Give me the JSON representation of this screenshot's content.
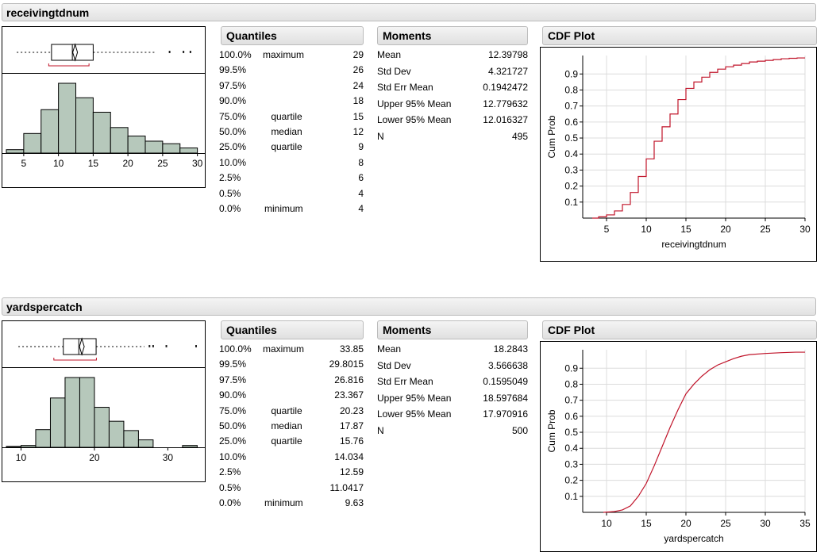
{
  "sections": [
    {
      "title": "receivingtdnum",
      "quantiles_title": "Quantiles",
      "moments_title": "Moments",
      "cdf_title": "CDF Plot",
      "quantiles": [
        {
          "pct": "100.0%",
          "label": "maximum",
          "value": "29"
        },
        {
          "pct": "99.5%",
          "label": "",
          "value": "26"
        },
        {
          "pct": "97.5%",
          "label": "",
          "value": "24"
        },
        {
          "pct": "90.0%",
          "label": "",
          "value": "18"
        },
        {
          "pct": "75.0%",
          "label": "quartile",
          "value": "15"
        },
        {
          "pct": "50.0%",
          "label": "median",
          "value": "12"
        },
        {
          "pct": "25.0%",
          "label": "quartile",
          "value": "9"
        },
        {
          "pct": "10.0%",
          "label": "",
          "value": "8"
        },
        {
          "pct": "2.5%",
          "label": "",
          "value": "6"
        },
        {
          "pct": "0.5%",
          "label": "",
          "value": "4"
        },
        {
          "pct": "0.0%",
          "label": "minimum",
          "value": "4"
        }
      ],
      "moments": [
        {
          "label": "Mean",
          "value": "12.39798"
        },
        {
          "label": "Std Dev",
          "value": "4.321727"
        },
        {
          "label": "Std Err Mean",
          "value": "0.1942472"
        },
        {
          "label": "Upper 95% Mean",
          "value": "12.779632"
        },
        {
          "label": "Lower 95% Mean",
          "value": "12.016327"
        },
        {
          "label": "N",
          "value": "495"
        }
      ]
    },
    {
      "title": "yardspercatch",
      "quantiles_title": "Quantiles",
      "moments_title": "Moments",
      "cdf_title": "CDF Plot",
      "quantiles": [
        {
          "pct": "100.0%",
          "label": "maximum",
          "value": "33.85"
        },
        {
          "pct": "99.5%",
          "label": "",
          "value": "29.8015"
        },
        {
          "pct": "97.5%",
          "label": "",
          "value": "26.816"
        },
        {
          "pct": "90.0%",
          "label": "",
          "value": "23.367"
        },
        {
          "pct": "75.0%",
          "label": "quartile",
          "value": "20.23"
        },
        {
          "pct": "50.0%",
          "label": "median",
          "value": "17.87"
        },
        {
          "pct": "25.0%",
          "label": "quartile",
          "value": "15.76"
        },
        {
          "pct": "10.0%",
          "label": "",
          "value": "14.034"
        },
        {
          "pct": "2.5%",
          "label": "",
          "value": "12.59"
        },
        {
          "pct": "0.5%",
          "label": "",
          "value": "11.0417"
        },
        {
          "pct": "0.0%",
          "label": "minimum",
          "value": "9.63"
        }
      ],
      "moments": [
        {
          "label": "Mean",
          "value": "18.2843"
        },
        {
          "label": "Std Dev",
          "value": "3.566638"
        },
        {
          "label": "Std Err Mean",
          "value": "0.1595049"
        },
        {
          "label": "Upper 95% Mean",
          "value": "18.597684"
        },
        {
          "label": "Lower 95% Mean",
          "value": "17.970916"
        },
        {
          "label": "N",
          "value": "500"
        }
      ]
    }
  ],
  "chart_data": [
    {
      "type": "bar",
      "variable": "receivingtdnum",
      "bin_edges": [
        2.5,
        5,
        7.5,
        10,
        12.5,
        15,
        17.5,
        20,
        22.5,
        25,
        27.5,
        30
      ],
      "values": [
        4,
        23,
        51,
        82,
        65,
        48,
        30,
        20,
        14,
        11,
        6
      ],
      "xticks": [
        "5",
        "10",
        "15",
        "20",
        "25",
        "30"
      ],
      "xlim": [
        2.5,
        30.5
      ],
      "boxplot": {
        "q1": 9,
        "median": 12,
        "q3": 15,
        "mean": 12.39798,
        "whisker_low": 4,
        "whisker_high": 24,
        "outliers": [
          26,
          28,
          29
        ]
      },
      "fill": "#b6c8bb",
      "line": "#000000"
    },
    {
      "type": "line",
      "variable": "receivingtdnum",
      "xlabel": "receivingtdnum",
      "ylabel": "Cum Prob",
      "xticks": [
        "5",
        "10",
        "15",
        "20",
        "25",
        "30"
      ],
      "yticks": [
        "0.1",
        "0.2",
        "0.3",
        "0.4",
        "0.5",
        "0.6",
        "0.7",
        "0.8",
        "0.9"
      ],
      "xlim": [
        2,
        30
      ],
      "ylim": [
        0,
        1
      ],
      "grid": true,
      "step": true,
      "x": [
        4,
        5,
        6,
        7,
        8,
        9,
        10,
        11,
        12,
        13,
        14,
        15,
        16,
        17,
        18,
        19,
        20,
        21,
        22,
        23,
        24,
        25,
        26,
        27,
        28,
        29
      ],
      "y": [
        0.008,
        0.02,
        0.045,
        0.085,
        0.16,
        0.26,
        0.37,
        0.48,
        0.57,
        0.65,
        0.74,
        0.81,
        0.85,
        0.88,
        0.91,
        0.93,
        0.945,
        0.955,
        0.965,
        0.975,
        0.98,
        0.985,
        0.99,
        0.995,
        0.998,
        1.0
      ],
      "color": "#c0142a"
    },
    {
      "type": "bar",
      "variable": "yardspercatch",
      "bin_edges": [
        8,
        10,
        12,
        14,
        16,
        18,
        20,
        22,
        24,
        26,
        28,
        30,
        32,
        34
      ],
      "values": [
        1,
        2,
        19,
        53,
        75,
        75,
        43,
        28,
        18,
        8,
        0,
        0,
        2
      ],
      "xticks": [
        "10",
        "20",
        "30"
      ],
      "xlim": [
        8,
        34.5
      ],
      "boxplot": {
        "q1": 15.76,
        "median": 17.87,
        "q3": 20.23,
        "mean": 18.2843,
        "whisker_low": 9.63,
        "whisker_high": 26.816,
        "outliers": [
          27.5,
          28,
          29.8,
          33.85
        ]
      },
      "fill": "#b6c8bb",
      "line": "#000000"
    },
    {
      "type": "line",
      "variable": "yardspercatch",
      "xlabel": "yardspercatch",
      "ylabel": "Cum Prob",
      "xticks": [
        "10",
        "15",
        "20",
        "25",
        "30",
        "35"
      ],
      "yticks": [
        "0.1",
        "0.2",
        "0.3",
        "0.4",
        "0.5",
        "0.6",
        "0.7",
        "0.8",
        "0.9"
      ],
      "xlim": [
        7,
        35
      ],
      "ylim": [
        0,
        1
      ],
      "grid": true,
      "step": false,
      "x": [
        9.6,
        11,
        12,
        13,
        14,
        15,
        16,
        17,
        18,
        19,
        20,
        21,
        22,
        23,
        24,
        25,
        26,
        27,
        28,
        30,
        32,
        33.85
      ],
      "y": [
        0,
        0.005,
        0.015,
        0.04,
        0.1,
        0.18,
        0.29,
        0.41,
        0.53,
        0.64,
        0.74,
        0.8,
        0.85,
        0.89,
        0.92,
        0.94,
        0.96,
        0.975,
        0.985,
        0.992,
        0.997,
        1.0
      ],
      "color": "#c0142a"
    }
  ]
}
